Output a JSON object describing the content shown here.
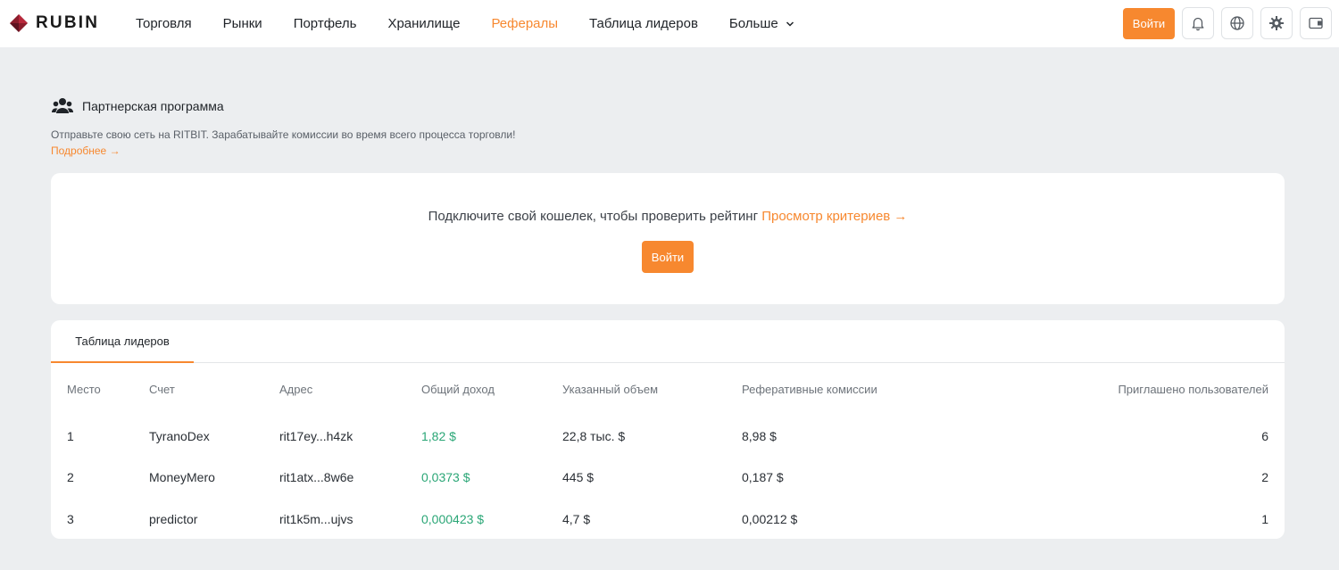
{
  "brand": {
    "name": "RUBIN"
  },
  "nav": {
    "items": [
      "Торговля",
      "Рынки",
      "Портфель",
      "Хранилище",
      "Рефералы",
      "Таблица лидеров"
    ],
    "more_label": "Больше",
    "active": "Рефералы"
  },
  "topbar": {
    "login_label": "Войти",
    "icons": [
      "bell-icon",
      "globe-icon",
      "gear-icon",
      "wallet-icon"
    ]
  },
  "intro": {
    "title": "Партнерская программа",
    "description": "Отправьте свою сеть на RITBIT. Зарабатывайте комиссии во время всего процесса торговли!",
    "more_link": "Подробнее →"
  },
  "connect": {
    "message": "Подключите свой кошелек, чтобы проверить рейтинг",
    "criteria_link": "Просмотр критериев →",
    "login_label": "Войти"
  },
  "leaderboard": {
    "tab_label": "Таблица лидеров",
    "columns": [
      "Место",
      "Счет",
      "Адрес",
      "Общий доход",
      "Указанный объем",
      "Реферативные комиссии",
      "Приглашено пользователей"
    ],
    "rows": [
      {
        "rank": "1",
        "account": "TyranoDex",
        "address": "rit17ey...h4zk",
        "income": "1,82 $",
        "volume": "22,8 тыс. $",
        "commissions": "8,98 $",
        "invited": "6"
      },
      {
        "rank": "2",
        "account": "MoneyMero",
        "address": "rit1atx...8w6e",
        "income": "0,0373 $",
        "volume": "445 $",
        "commissions": "0,187 $",
        "invited": "2"
      },
      {
        "rank": "3",
        "account": "predictor",
        "address": "rit1k5m...ujvs",
        "income": "0,000423 $",
        "volume": "4,7 $",
        "commissions": "0,00212 $",
        "invited": "1"
      }
    ]
  },
  "colors": {
    "accent": "#f7882f",
    "positive": "#2aa676",
    "background": "#eceef0"
  }
}
